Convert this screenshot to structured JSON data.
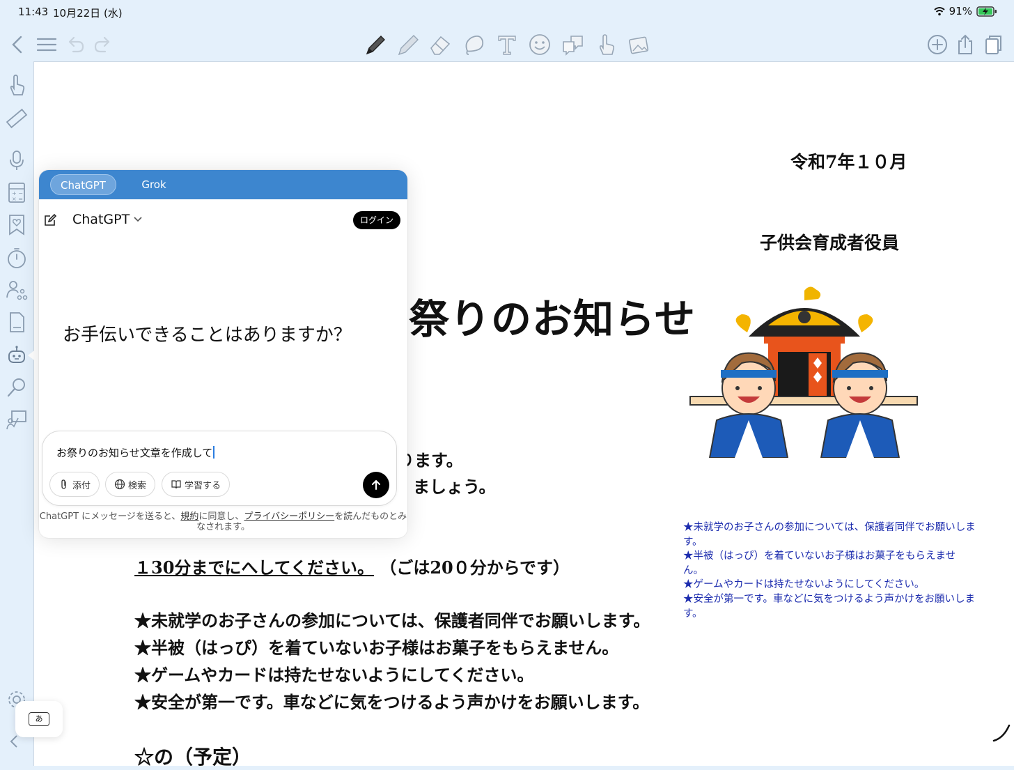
{
  "status_bar": {
    "time": "11:43",
    "date": "10月22日 (水)",
    "battery": "91%"
  },
  "assistant": {
    "tabs": [
      "ChatGPT",
      "Grok"
    ],
    "model": "ChatGPT",
    "login": "ログイン",
    "greeting": "お手伝いできることはありますか？",
    "input_value": "お祭りのお知らせ文章を作成して",
    "chips": {
      "attach": "添付",
      "search": "検索",
      "study": "学習する"
    },
    "disclaimer": {
      "pre": "ChatGPT にメッセージを送ると、",
      "terms": "規約",
      "mid": "に同意し、",
      "privacy": "プライバシーポリシー",
      "post": "を読んだものとみなされます。"
    }
  },
  "document": {
    "date": "令和7年１０月",
    "org": "子供会育成者役員",
    "title": "祭りのお知らせ",
    "partial_line1": "ります。",
    "partial_line2": "ましょう。",
    "time_note_underlined": "１30分までにへしてください。",
    "time_note_rest": "（ごは20０分からです）",
    "rules": [
      "★未就学のお子さんの参加については、保護者同伴でお願いします。",
      "★半被（はっぴ）を着ていないお子様はお菓子をもらえません。",
      "★ゲームやカードは持たせないようにしてください。",
      "★安全が第一です。車などに気をつけるよう声かけをお願いします。"
    ],
    "plan_heading": "☆の（予定）",
    "note_box": [
      "★未就学のお子さんの参加については、保護者同伴でお願いします。",
      "★半被（はっぴ）を着ていないお子様はお菓子をもらえません。",
      "★ゲームやカードは持たせないようにしてください。",
      "★安全が第一です。車などに気をつけるよう声かけをお願いします。"
    ]
  },
  "ime": {
    "label": "あ"
  },
  "colors": {
    "toolbar_bg": "#e4f0fb",
    "tab_bar": "#3d86cf",
    "note_text": "#1c2cae"
  }
}
